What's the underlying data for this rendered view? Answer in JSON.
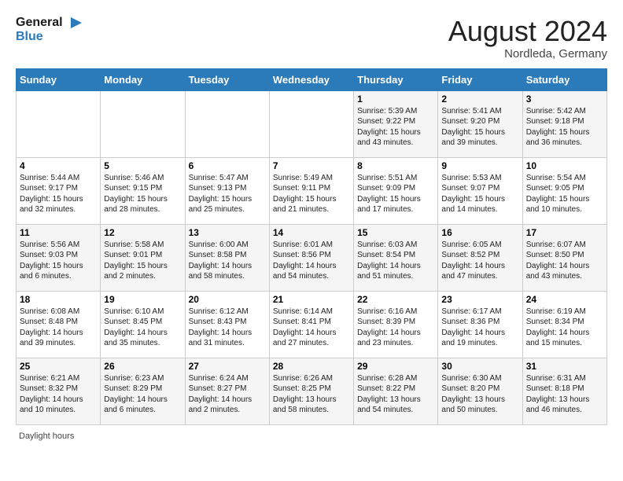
{
  "header": {
    "logo_line1": "General",
    "logo_line2": "Blue",
    "month_title": "August 2024",
    "location": "Nordleda, Germany"
  },
  "days_of_week": [
    "Sunday",
    "Monday",
    "Tuesday",
    "Wednesday",
    "Thursday",
    "Friday",
    "Saturday"
  ],
  "weeks": [
    [
      {
        "day": "",
        "info": ""
      },
      {
        "day": "",
        "info": ""
      },
      {
        "day": "",
        "info": ""
      },
      {
        "day": "",
        "info": ""
      },
      {
        "day": "1",
        "info": "Sunrise: 5:39 AM\nSunset: 9:22 PM\nDaylight: 15 hours and 43 minutes."
      },
      {
        "day": "2",
        "info": "Sunrise: 5:41 AM\nSunset: 9:20 PM\nDaylight: 15 hours and 39 minutes."
      },
      {
        "day": "3",
        "info": "Sunrise: 5:42 AM\nSunset: 9:18 PM\nDaylight: 15 hours and 36 minutes."
      }
    ],
    [
      {
        "day": "4",
        "info": "Sunrise: 5:44 AM\nSunset: 9:17 PM\nDaylight: 15 hours and 32 minutes."
      },
      {
        "day": "5",
        "info": "Sunrise: 5:46 AM\nSunset: 9:15 PM\nDaylight: 15 hours and 28 minutes."
      },
      {
        "day": "6",
        "info": "Sunrise: 5:47 AM\nSunset: 9:13 PM\nDaylight: 15 hours and 25 minutes."
      },
      {
        "day": "7",
        "info": "Sunrise: 5:49 AM\nSunset: 9:11 PM\nDaylight: 15 hours and 21 minutes."
      },
      {
        "day": "8",
        "info": "Sunrise: 5:51 AM\nSunset: 9:09 PM\nDaylight: 15 hours and 17 minutes."
      },
      {
        "day": "9",
        "info": "Sunrise: 5:53 AM\nSunset: 9:07 PM\nDaylight: 15 hours and 14 minutes."
      },
      {
        "day": "10",
        "info": "Sunrise: 5:54 AM\nSunset: 9:05 PM\nDaylight: 15 hours and 10 minutes."
      }
    ],
    [
      {
        "day": "11",
        "info": "Sunrise: 5:56 AM\nSunset: 9:03 PM\nDaylight: 15 hours and 6 minutes."
      },
      {
        "day": "12",
        "info": "Sunrise: 5:58 AM\nSunset: 9:01 PM\nDaylight: 15 hours and 2 minutes."
      },
      {
        "day": "13",
        "info": "Sunrise: 6:00 AM\nSunset: 8:58 PM\nDaylight: 14 hours and 58 minutes."
      },
      {
        "day": "14",
        "info": "Sunrise: 6:01 AM\nSunset: 8:56 PM\nDaylight: 14 hours and 54 minutes."
      },
      {
        "day": "15",
        "info": "Sunrise: 6:03 AM\nSunset: 8:54 PM\nDaylight: 14 hours and 51 minutes."
      },
      {
        "day": "16",
        "info": "Sunrise: 6:05 AM\nSunset: 8:52 PM\nDaylight: 14 hours and 47 minutes."
      },
      {
        "day": "17",
        "info": "Sunrise: 6:07 AM\nSunset: 8:50 PM\nDaylight: 14 hours and 43 minutes."
      }
    ],
    [
      {
        "day": "18",
        "info": "Sunrise: 6:08 AM\nSunset: 8:48 PM\nDaylight: 14 hours and 39 minutes."
      },
      {
        "day": "19",
        "info": "Sunrise: 6:10 AM\nSunset: 8:45 PM\nDaylight: 14 hours and 35 minutes."
      },
      {
        "day": "20",
        "info": "Sunrise: 6:12 AM\nSunset: 8:43 PM\nDaylight: 14 hours and 31 minutes."
      },
      {
        "day": "21",
        "info": "Sunrise: 6:14 AM\nSunset: 8:41 PM\nDaylight: 14 hours and 27 minutes."
      },
      {
        "day": "22",
        "info": "Sunrise: 6:16 AM\nSunset: 8:39 PM\nDaylight: 14 hours and 23 minutes."
      },
      {
        "day": "23",
        "info": "Sunrise: 6:17 AM\nSunset: 8:36 PM\nDaylight: 14 hours and 19 minutes."
      },
      {
        "day": "24",
        "info": "Sunrise: 6:19 AM\nSunset: 8:34 PM\nDaylight: 14 hours and 15 minutes."
      }
    ],
    [
      {
        "day": "25",
        "info": "Sunrise: 6:21 AM\nSunset: 8:32 PM\nDaylight: 14 hours and 10 minutes."
      },
      {
        "day": "26",
        "info": "Sunrise: 6:23 AM\nSunset: 8:29 PM\nDaylight: 14 hours and 6 minutes."
      },
      {
        "day": "27",
        "info": "Sunrise: 6:24 AM\nSunset: 8:27 PM\nDaylight: 14 hours and 2 minutes."
      },
      {
        "day": "28",
        "info": "Sunrise: 6:26 AM\nSunset: 8:25 PM\nDaylight: 13 hours and 58 minutes."
      },
      {
        "day": "29",
        "info": "Sunrise: 6:28 AM\nSunset: 8:22 PM\nDaylight: 13 hours and 54 minutes."
      },
      {
        "day": "30",
        "info": "Sunrise: 6:30 AM\nSunset: 8:20 PM\nDaylight: 13 hours and 50 minutes."
      },
      {
        "day": "31",
        "info": "Sunrise: 6:31 AM\nSunset: 8:18 PM\nDaylight: 13 hours and 46 minutes."
      }
    ]
  ],
  "footer": {
    "daylight_label": "Daylight hours"
  }
}
